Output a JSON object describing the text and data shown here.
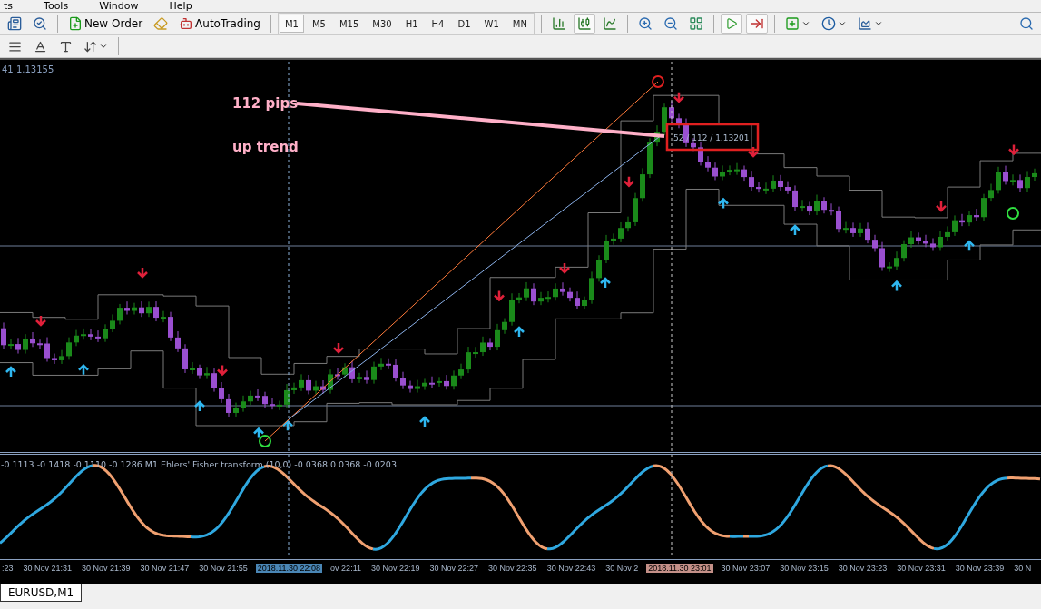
{
  "menu_bar": [
    "ts",
    "Tools",
    "Window",
    "Help"
  ],
  "toolbar": {
    "new_order": "New Order",
    "autotrading": "AutoTrading",
    "timeframes": [
      {
        "label": "M1",
        "selected": true
      },
      {
        "label": "M5",
        "selected": false
      },
      {
        "label": "M15",
        "selected": false
      },
      {
        "label": "M30",
        "selected": false
      },
      {
        "label": "H1",
        "selected": false
      },
      {
        "label": "H4",
        "selected": false
      },
      {
        "label": "D1",
        "selected": false
      },
      {
        "label": "W1",
        "selected": false
      },
      {
        "label": "MN",
        "selected": false
      }
    ],
    "chart_modes": [
      {
        "kind": "bar",
        "selected": false
      },
      {
        "kind": "candle",
        "selected": true
      },
      {
        "kind": "line",
        "selected": false
      }
    ],
    "scroll_modes": [
      {
        "kind": "autoscroll",
        "selected": true
      },
      {
        "kind": "shift",
        "selected": true
      }
    ]
  },
  "chart": {
    "price_label": "41 1.13155",
    "annotations": [
      {
        "text": "112 pips"
      },
      {
        "text": "up trend"
      }
    ],
    "measure_label": "52 / 112 / 1.13201",
    "indicator_label": "-0.1113 -0.1418 -0.1110 -0.1286  M1 Ehlers' Fisher transform (10,0) -0.0368 0.0368 -0.0203",
    "time_axis": [
      {
        "label": ":23",
        "kind": "tick"
      },
      {
        "label": "30 Nov 21:31",
        "kind": "tick"
      },
      {
        "label": "30 Nov 21:39",
        "kind": "tick"
      },
      {
        "label": "30 Nov 21:47",
        "kind": "tick"
      },
      {
        "label": "30 Nov 21:55",
        "kind": "tick"
      },
      {
        "label": "2018.11.30 22:08",
        "kind": "marker",
        "color": "#4a86b5"
      },
      {
        "label": "ov 22:11",
        "kind": "tick"
      },
      {
        "label": "30 Nov 22:19",
        "kind": "tick"
      },
      {
        "label": "30 Nov 22:27",
        "kind": "tick"
      },
      {
        "label": "30 Nov 22:35",
        "kind": "tick"
      },
      {
        "label": "30 Nov 22:43",
        "kind": "tick"
      },
      {
        "label": "30 Nov 2",
        "kind": "tick"
      },
      {
        "label": "2018.11.30 23:01",
        "kind": "marker",
        "color": "#c49088"
      },
      {
        "label": "30 Nov 23:07",
        "kind": "tick"
      },
      {
        "label": "30 Nov 23:15",
        "kind": "tick"
      },
      {
        "label": "30 Nov 23:23",
        "kind": "tick"
      },
      {
        "label": "30 Nov 23:31",
        "kind": "tick"
      },
      {
        "label": "30 Nov 23:39",
        "kind": "tick"
      },
      {
        "label": "30 N",
        "kind": "tick"
      }
    ]
  },
  "tabs": [
    {
      "label": "EURUSD,M1",
      "selected": true
    }
  ]
}
